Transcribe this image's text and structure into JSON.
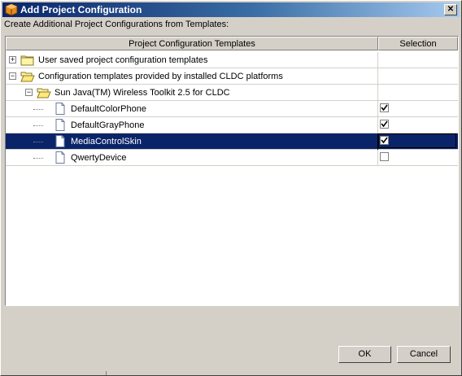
{
  "window": {
    "title": "Add Project Configuration",
    "close_symbol": "✕"
  },
  "subtitle": "Create Additional Project Configurations from Templates:",
  "table": {
    "columns": [
      "Project Configuration Templates",
      "Selection"
    ],
    "rows": [
      {
        "label": "User saved project configuration templates",
        "type": "folder",
        "expander": "+",
        "level": 0,
        "checked": null,
        "selected": false
      },
      {
        "label": "Configuration templates provided by installed CLDC platforms",
        "type": "folder-open",
        "expander": "−",
        "level": 0,
        "checked": null,
        "selected": false
      },
      {
        "label": "Sun Java(TM) Wireless Toolkit 2.5 for CLDC",
        "type": "folder-open",
        "expander": "−",
        "level": 1,
        "checked": null,
        "selected": false
      },
      {
        "label": "DefaultColorPhone",
        "type": "file",
        "expander": null,
        "level": 2,
        "checked": true,
        "selected": false
      },
      {
        "label": "DefaultGrayPhone",
        "type": "file",
        "expander": null,
        "level": 2,
        "checked": true,
        "selected": false
      },
      {
        "label": "MediaControlSkin",
        "type": "file",
        "expander": null,
        "level": 2,
        "checked": true,
        "selected": true
      },
      {
        "label": "QwertyDevice",
        "type": "file",
        "expander": null,
        "level": 2,
        "checked": false,
        "selected": false
      }
    ]
  },
  "buttons": {
    "ok": "OK",
    "cancel": "Cancel"
  },
  "icons": {
    "title": "netbeans-cube-icon",
    "folder": "folder-icon",
    "folder_open": "folder-open-icon",
    "file": "document-icon",
    "check": "✓"
  },
  "colors": {
    "title_bar": "#0a246a",
    "selection": "#0a246a",
    "dialog_bg": "#d4d0c8"
  }
}
